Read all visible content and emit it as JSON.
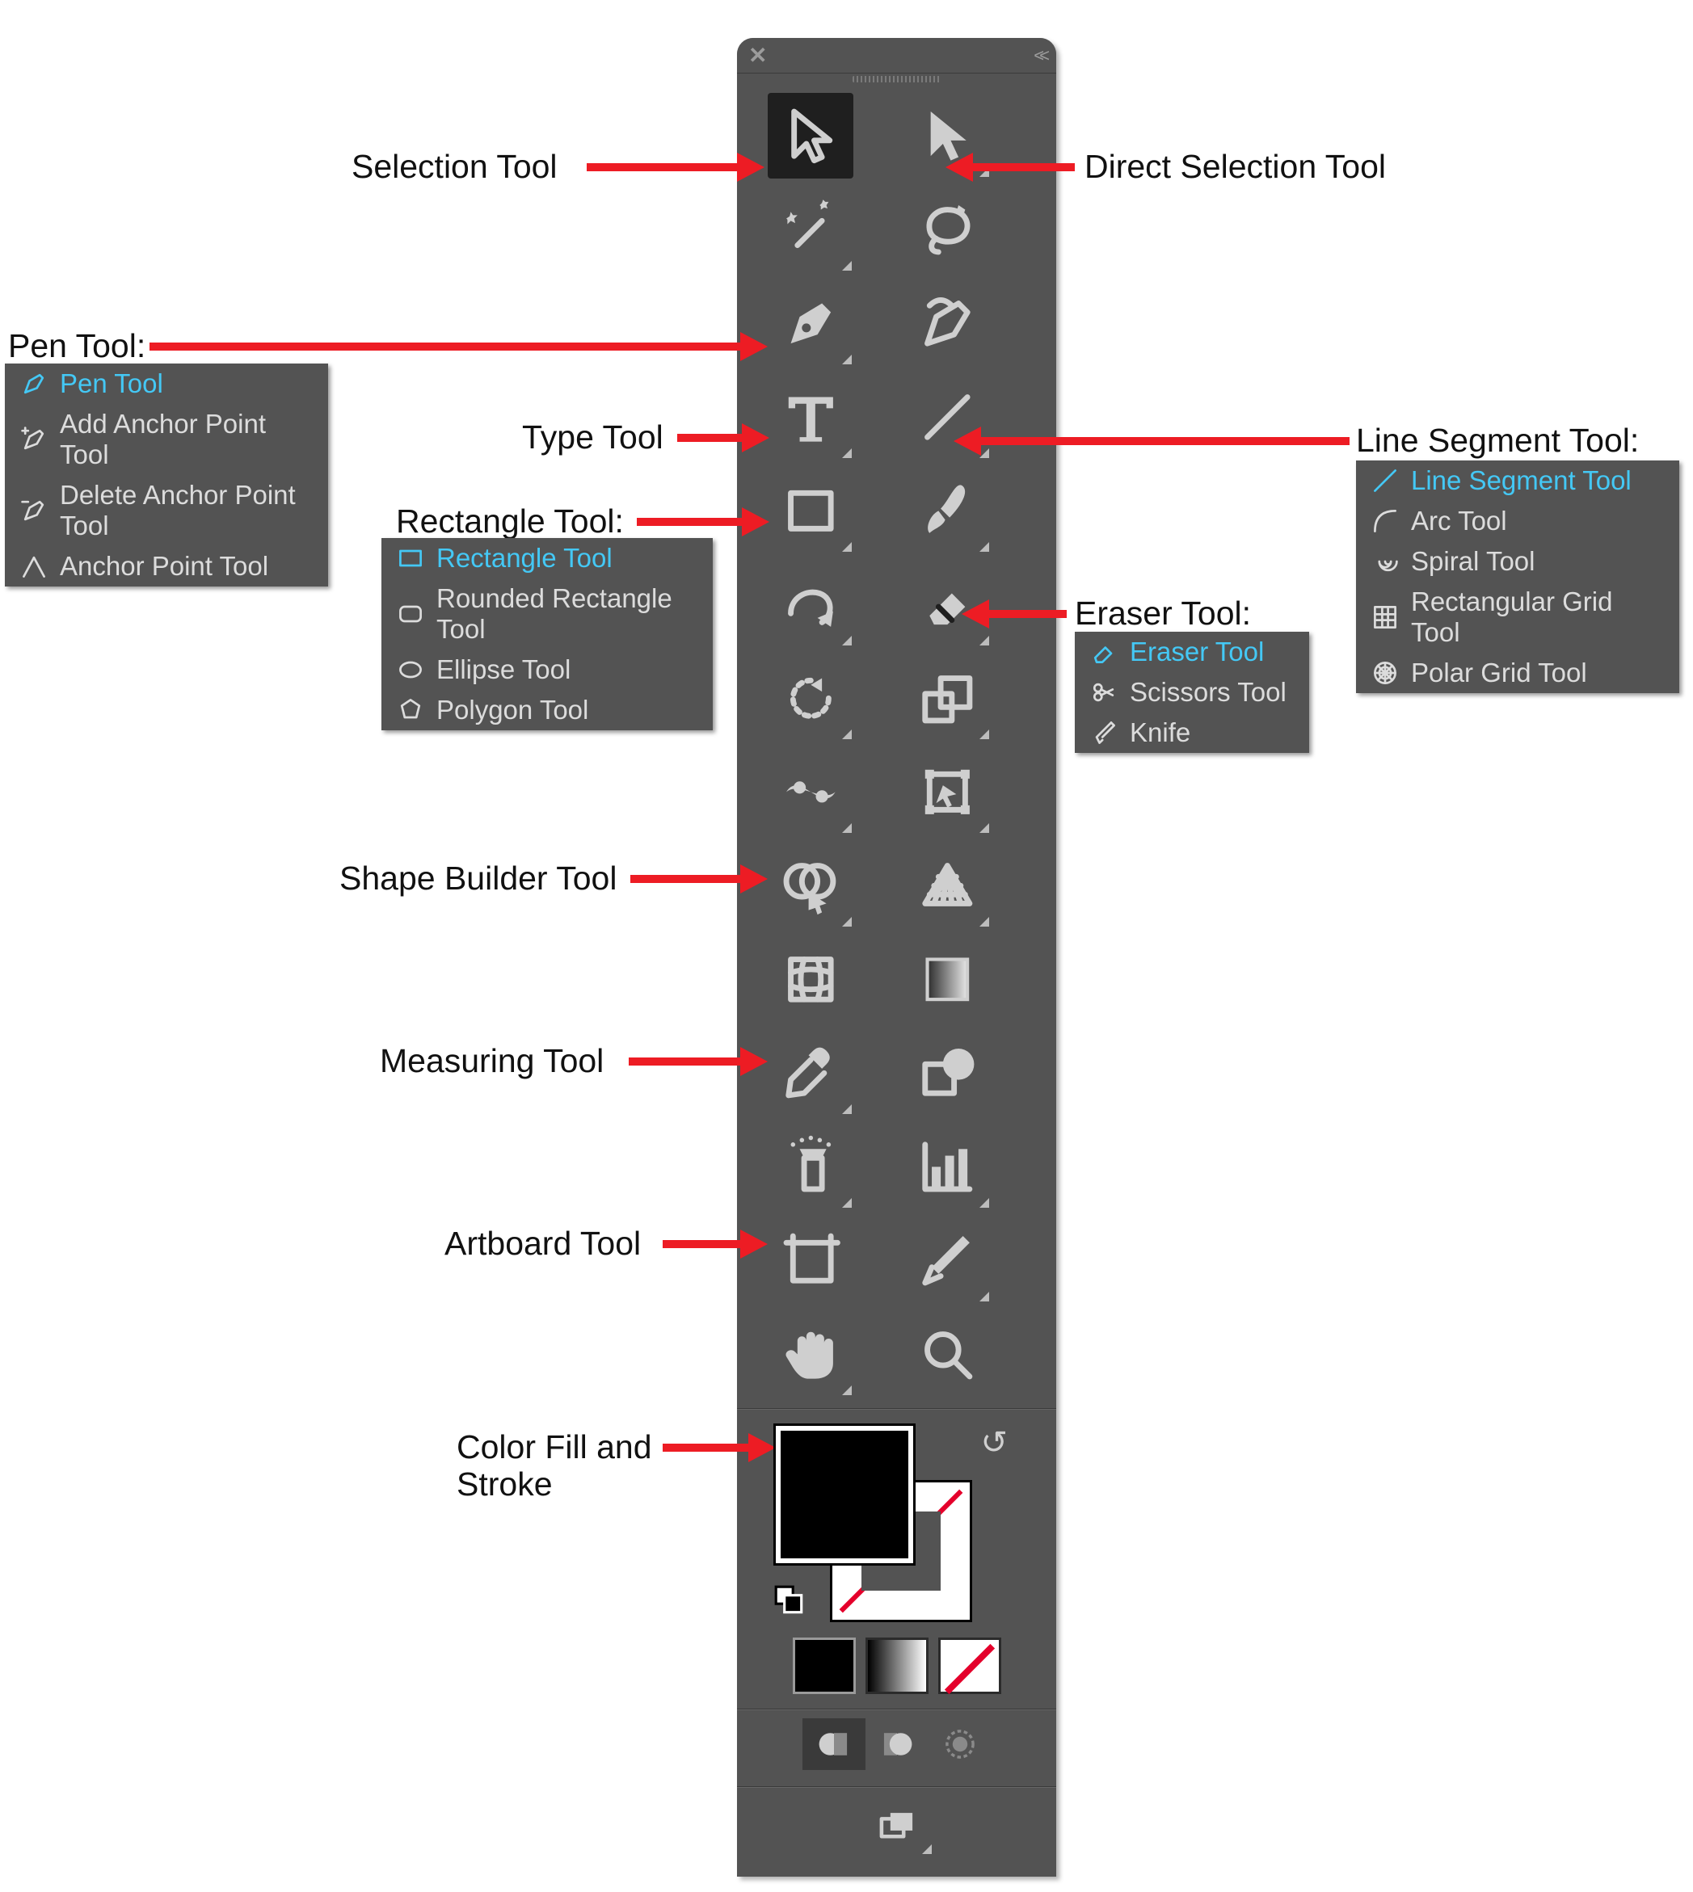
{
  "annotations": {
    "selection": "Selection Tool",
    "direct_selection": "Direct Selection Tool",
    "pen": "Pen Tool:",
    "type": "Type Tool",
    "rectangle": "Rectangle Tool:",
    "line_segment": "Line Segment Tool:",
    "eraser": "Eraser Tool:",
    "shape_builder": "Shape Builder Tool",
    "measuring": "Measuring Tool",
    "artboard": "Artboard Tool",
    "color_fill_stroke_l1": "Color Fill and",
    "color_fill_stroke_l2": "Stroke"
  },
  "flyouts": {
    "pen": {
      "items": [
        {
          "label": "Pen Tool",
          "selected": true,
          "icon": "pen"
        },
        {
          "label": "Add Anchor Point Tool",
          "selected": false,
          "icon": "pen-plus"
        },
        {
          "label": "Delete Anchor Point Tool",
          "selected": false,
          "icon": "pen-minus"
        },
        {
          "label": "Anchor Point Tool",
          "selected": false,
          "icon": "anchor-convert"
        }
      ]
    },
    "rectangle": {
      "items": [
        {
          "label": "Rectangle Tool",
          "selected": true,
          "icon": "rect"
        },
        {
          "label": "Rounded Rectangle Tool",
          "selected": false,
          "icon": "round-rect"
        },
        {
          "label": "Ellipse Tool",
          "selected": false,
          "icon": "ellipse"
        },
        {
          "label": "Polygon Tool",
          "selected": false,
          "icon": "polygon"
        }
      ]
    },
    "line": {
      "items": [
        {
          "label": "Line Segment Tool",
          "selected": true,
          "icon": "line"
        },
        {
          "label": "Arc Tool",
          "selected": false,
          "icon": "arc"
        },
        {
          "label": "Spiral Tool",
          "selected": false,
          "icon": "spiral"
        },
        {
          "label": "Rectangular Grid Tool",
          "selected": false,
          "icon": "rect-grid"
        },
        {
          "label": "Polar Grid Tool",
          "selected": false,
          "icon": "polar-grid"
        }
      ]
    },
    "eraser": {
      "items": [
        {
          "label": "Eraser Tool",
          "selected": true,
          "icon": "eraser"
        },
        {
          "label": "Scissors Tool",
          "selected": false,
          "icon": "scissors"
        },
        {
          "label": "Knife",
          "selected": false,
          "icon": "knife"
        }
      ]
    }
  },
  "toolbar": {
    "tools": [
      {
        "name": "selection-tool",
        "fly": false,
        "selected": true
      },
      {
        "name": "direct-selection-tool",
        "fly": true
      },
      {
        "name": "magic-wand-tool",
        "fly": true
      },
      {
        "name": "lasso-tool",
        "fly": false
      },
      {
        "name": "pen-tool",
        "fly": true
      },
      {
        "name": "curvature-tool",
        "fly": false
      },
      {
        "name": "type-tool",
        "fly": true
      },
      {
        "name": "line-segment-tool",
        "fly": true
      },
      {
        "name": "rectangle-tool",
        "fly": true
      },
      {
        "name": "paintbrush-tool",
        "fly": true
      },
      {
        "name": "shaper-tool",
        "fly": true
      },
      {
        "name": "eraser-tool",
        "fly": true
      },
      {
        "name": "rotate-tool",
        "fly": true
      },
      {
        "name": "scale-tool",
        "fly": true
      },
      {
        "name": "width-tool",
        "fly": true
      },
      {
        "name": "free-transform-tool",
        "fly": true
      },
      {
        "name": "shape-builder-tool",
        "fly": true
      },
      {
        "name": "perspective-grid-tool",
        "fly": true
      },
      {
        "name": "mesh-tool",
        "fly": false
      },
      {
        "name": "gradient-tool",
        "fly": false
      },
      {
        "name": "eyedropper-tool",
        "fly": true
      },
      {
        "name": "blend-tool",
        "fly": false
      },
      {
        "name": "symbol-sprayer-tool",
        "fly": true
      },
      {
        "name": "column-graph-tool",
        "fly": true
      },
      {
        "name": "artboard-tool",
        "fly": false
      },
      {
        "name": "slice-tool",
        "fly": true
      },
      {
        "name": "hand-tool",
        "fly": true
      },
      {
        "name": "zoom-tool",
        "fly": false
      }
    ]
  }
}
